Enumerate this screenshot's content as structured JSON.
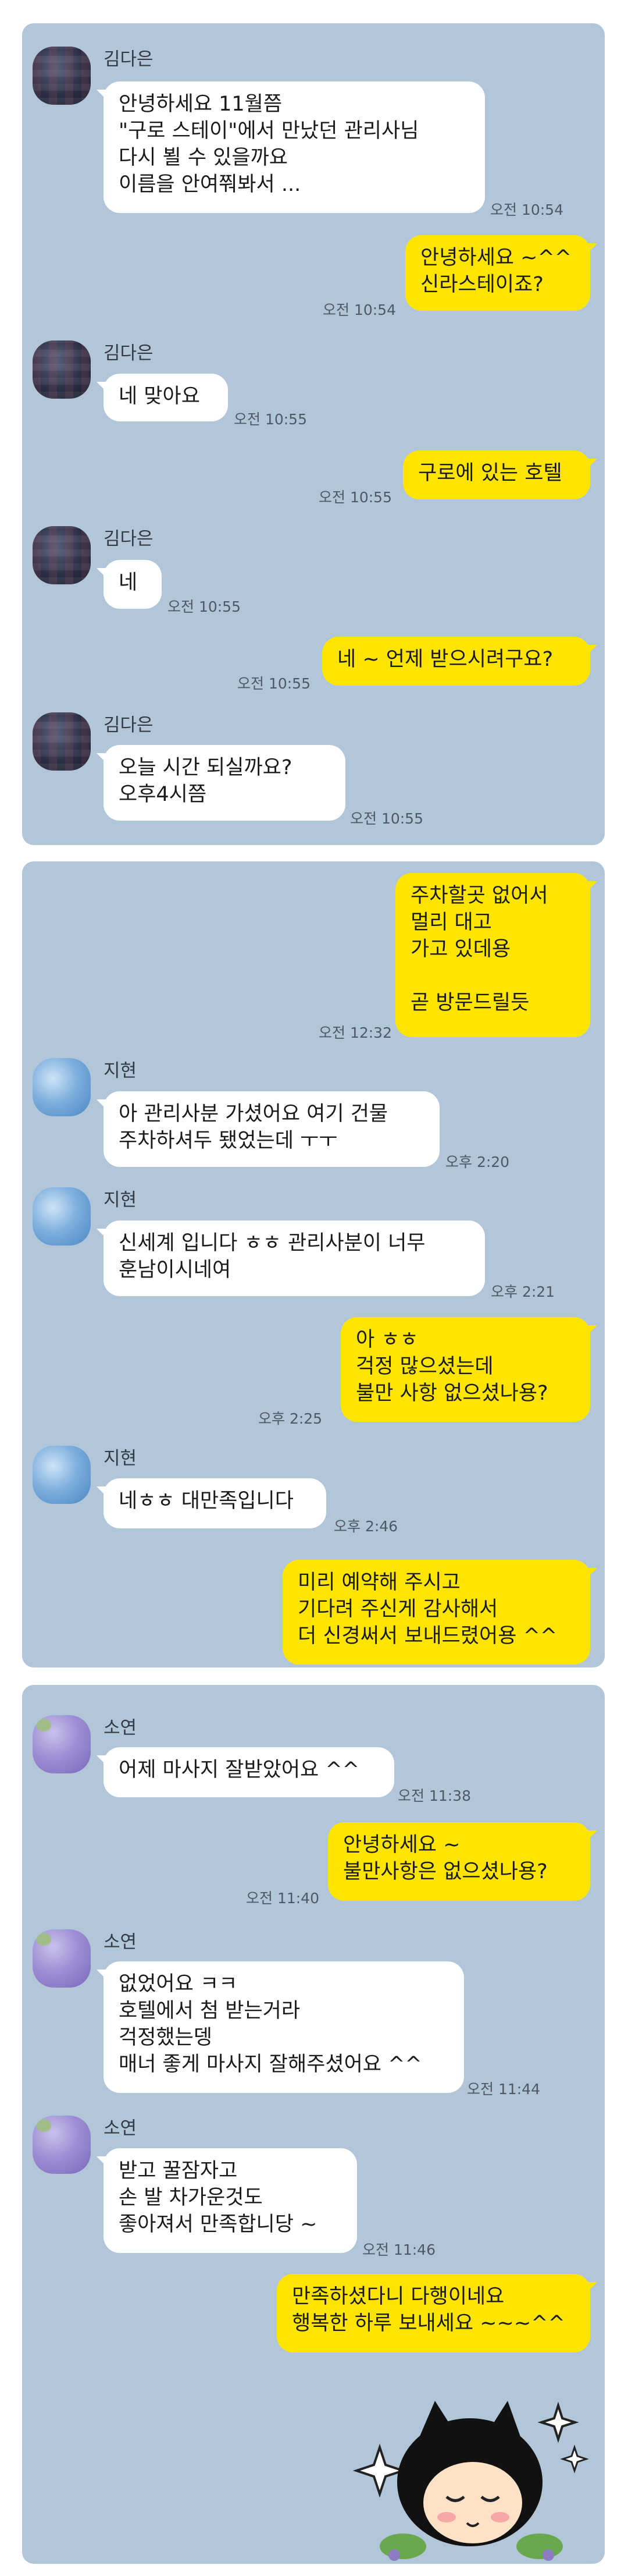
{
  "colors": {
    "chat_bg": "#b2c6da",
    "outgoing_bubble": "#fee500",
    "incoming_bubble": "#ffffff"
  },
  "panel1": {
    "messages": [
      {
        "sender": "김다은",
        "text": "안녕하세요 11월쯤\n\"구로 스테이\"에서 만났던 관리사님\n다시 뵐 수 있을까요\n이름을 안여쭤봐서 ...",
        "time": "오전 10:54"
      },
      {
        "text": "안녕하세요 ~^^\n신라스테이죠?",
        "time": "오전 10:54"
      },
      {
        "sender": "김다은",
        "text": "네 맞아요",
        "time": "오전 10:55"
      },
      {
        "text": "구로에 있는 호텔",
        "time": "오전 10:55"
      },
      {
        "sender": "김다은",
        "text": "네",
        "time": "오전 10:55"
      },
      {
        "text": "네 ~ 언제 받으시려구요?",
        "time": "오전 10:55"
      },
      {
        "sender": "김다은",
        "text": "오늘 시간 되실까요?\n오후4시쯤",
        "time": "오전 10:55"
      }
    ]
  },
  "panel2": {
    "messages": [
      {
        "text": "주차할곳 없어서\n멀리 대고\n가고 있데용\n\n곧 방문드릴듯",
        "time": "오전 12:32"
      },
      {
        "sender": "지현",
        "text": "아 관리사분 가셨어요 여기 건물\n주차하셔두 됐었는데 ㅜㅜ",
        "time": "오후 2:20"
      },
      {
        "sender": "지현",
        "text": "신세계 입니다 ㅎㅎ 관리사분이 너무\n훈남이시네여",
        "time": "오후 2:21"
      },
      {
        "text": "아 ㅎㅎ\n걱정 많으셨는데\n불만 사항 없으셨나용?",
        "time": "오후 2:25"
      },
      {
        "sender": "지현",
        "text": "네ㅎㅎ 대만족입니다",
        "time": "오후 2:46"
      },
      {
        "text": "미리 예약해 주시고\n기다려 주신게 감사해서\n더 신경써서 보내드렸어용 ^^"
      }
    ]
  },
  "panel3": {
    "messages": [
      {
        "sender": "소연",
        "text": "어제 마사지 잘받았어요 ^^",
        "time": "오전 11:38"
      },
      {
        "text": "안녕하세요 ~\n불만사항은 없으셨나용?",
        "time": "오전 11:40"
      },
      {
        "sender": "소연",
        "text": "없었어요 ㅋㅋ\n호텔에서 첨 받는거라\n걱정했는뎅\n매너 좋게 마사지 잘해주셨어요 ^^",
        "time": "오전 11:44"
      },
      {
        "sender": "소연",
        "text": "받고 꿀잠자고\n손 발 차가운것도\n좋아져서 만족합니당 ~",
        "time": "오전 11:46"
      },
      {
        "text": "만족하셨다니 다행이네요\n행복한 하루 보내세요 ~~~^^"
      }
    ],
    "sticker": "black-cat-sticker"
  }
}
